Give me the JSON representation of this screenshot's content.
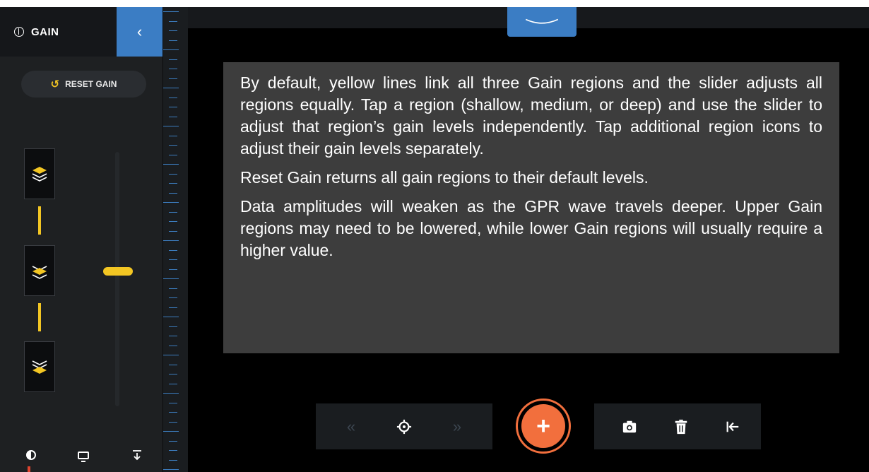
{
  "panel": {
    "title": "GAIN",
    "collapse_glyph": "‹",
    "reset_label": "RESET GAIN",
    "reset_glyph": "↺",
    "regions": [
      "shallow",
      "medium",
      "deep"
    ],
    "slider_level": 0.45,
    "bottom": {
      "contrast": "contrast-icon",
      "display": "display-icon",
      "depth": "depth-icon"
    }
  },
  "info": {
    "paragraphs": [
      "By default, yellow lines link all three Gain regions and the slider adjusts all regions equally. Tap a region (shallow, medium, or deep) and use the slider to adjust that region’s gain levels independently. Tap additional region icons to adjust their gain levels separately.",
      "Reset Gain returns all gain regions to their default levels.",
      "Data amplitudes will weaken as the GPR wave travels deeper. Upper Gain regions may need to be lowered, while lower Gain regions will usually require a higher value."
    ]
  },
  "toolbar": {
    "rewind_glyph": "«",
    "forward_glyph": "»",
    "add_glyph": "+"
  },
  "colors": {
    "accent_blue": "#3b7dc4",
    "link_yellow": "#f3c623",
    "add_orange": "#f26f3d",
    "overlay_gray": "#3d3d3d"
  }
}
